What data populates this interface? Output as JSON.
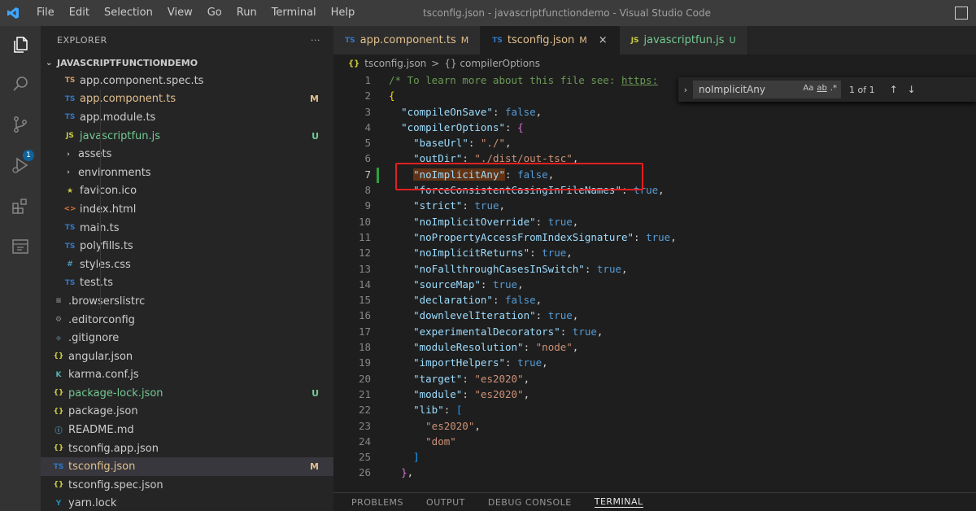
{
  "menu": [
    "File",
    "Edit",
    "Selection",
    "View",
    "Go",
    "Run",
    "Terminal",
    "Help"
  ],
  "window_title": "tsconfig.json - javascriptfunctiondemo - Visual Studio Code",
  "activity_badge": "1",
  "explorer": {
    "header": "EXPLORER",
    "more": "···",
    "root": "JAVASCRIPTFUNCTIONDEMO",
    "items": [
      {
        "icon": "TS",
        "label": "app.component.spec.ts",
        "badge": "",
        "color": "#cccccc",
        "icon_color": "#d19a66"
      },
      {
        "icon": "TS",
        "label": "app.component.ts",
        "badge": "M",
        "color": "#e2c08d",
        "icon_color": "#3178c6"
      },
      {
        "icon": "TS",
        "label": "app.module.ts",
        "badge": "",
        "color": "#cccccc",
        "icon_color": "#3178c6"
      },
      {
        "icon": "JS",
        "label": "javascriptfun.js",
        "badge": "U",
        "color": "#73c991",
        "icon_color": "#cbcb41"
      },
      {
        "icon": "›",
        "label": "assets",
        "badge": "",
        "color": "#cccccc",
        "icon_color": "#cccccc"
      },
      {
        "icon": "›",
        "label": "environments",
        "badge": "",
        "color": "#cccccc",
        "icon_color": "#cccccc"
      },
      {
        "icon": "★",
        "label": "favicon.ico",
        "badge": "",
        "color": "#cccccc",
        "icon_color": "#cbcb41"
      },
      {
        "icon": "<>",
        "label": "index.html",
        "badge": "",
        "color": "#cccccc",
        "icon_color": "#e37933"
      },
      {
        "icon": "TS",
        "label": "main.ts",
        "badge": "",
        "color": "#cccccc",
        "icon_color": "#3178c6"
      },
      {
        "icon": "TS",
        "label": "polyfills.ts",
        "badge": "",
        "color": "#cccccc",
        "icon_color": "#3178c6"
      },
      {
        "icon": "#",
        "label": "styles.css",
        "badge": "",
        "color": "#cccccc",
        "icon_color": "#519aba"
      },
      {
        "icon": "TS",
        "label": "test.ts",
        "badge": "",
        "color": "#cccccc",
        "icon_color": "#3178c6"
      },
      {
        "icon": "≡",
        "label": ".browserslistrc",
        "badge": "",
        "color": "#cccccc",
        "icon_color": "#8a8a8a"
      },
      {
        "icon": "⚙",
        "label": ".editorconfig",
        "badge": "",
        "color": "#cccccc",
        "icon_color": "#8a8a8a"
      },
      {
        "icon": "◆",
        "label": ".gitignore",
        "badge": "",
        "color": "#cccccc",
        "icon_color": "#41535b"
      },
      {
        "icon": "{}",
        "label": "angular.json",
        "badge": "",
        "color": "#cccccc",
        "icon_color": "#cbcb41"
      },
      {
        "icon": "K",
        "label": "karma.conf.js",
        "badge": "",
        "color": "#cccccc",
        "icon_color": "#56b3b4"
      },
      {
        "icon": "{}",
        "label": "package-lock.json",
        "badge": "U",
        "color": "#73c991",
        "icon_color": "#cbcb41"
      },
      {
        "icon": "{}",
        "label": "package.json",
        "badge": "",
        "color": "#cccccc",
        "icon_color": "#cbcb41"
      },
      {
        "icon": "ⓘ",
        "label": "README.md",
        "badge": "",
        "color": "#cccccc",
        "icon_color": "#519aba"
      },
      {
        "icon": "{}",
        "label": "tsconfig.app.json",
        "badge": "",
        "color": "#cccccc",
        "icon_color": "#cbcb41"
      },
      {
        "icon": "TS",
        "label": "tsconfig.json",
        "badge": "M",
        "color": "#e2c08d",
        "icon_color": "#3178c6",
        "selected": true
      },
      {
        "icon": "{}",
        "label": "tsconfig.spec.json",
        "badge": "",
        "color": "#cccccc",
        "icon_color": "#cbcb41"
      },
      {
        "icon": "Y",
        "label": "yarn.lock",
        "badge": "",
        "color": "#cccccc",
        "icon_color": "#2c8ebb"
      }
    ]
  },
  "tabs": [
    {
      "icon": "TS",
      "label": "app.component.ts",
      "suffix": "M",
      "active": false,
      "color": "#e2c08d",
      "icon_color": "#3178c6"
    },
    {
      "icon": "TS",
      "label": "tsconfig.json",
      "suffix": "M",
      "active": true,
      "color": "#e2c08d",
      "icon_color": "#3178c6",
      "close": "×"
    },
    {
      "icon": "JS",
      "label": "javascriptfun.js",
      "suffix": "U",
      "active": false,
      "color": "#73c991",
      "icon_color": "#cbcb41"
    }
  ],
  "breadcrumb": {
    "file": "tsconfig.json",
    "sep": ">",
    "symbol": "{} compilerOptions"
  },
  "find": {
    "value": "noImplicitAny",
    "options": [
      "Aa",
      "ab",
      ".*"
    ],
    "count": "1 of 1",
    "prev": "↑",
    "next": "↓"
  },
  "code_lines": [
    {
      "n": "1",
      "html": "<span class='c'>/* To learn more about this file see: </span><span class='url'>https:</span>"
    },
    {
      "n": "2",
      "html": "<span class='br'>{</span>"
    },
    {
      "n": "3",
      "html": "  <span class='k'>\"compileOnSave\"</span><span class='p'>: </span><span class='b'>false</span><span class='p'>,</span>"
    },
    {
      "n": "4",
      "html": "  <span class='k'>\"compilerOptions\"</span><span class='p'>: </span><span class='br2'>{</span>"
    },
    {
      "n": "5",
      "html": "    <span class='k'>\"baseUrl\"</span><span class='p'>: </span><span class='s'>\"./\"</span><span class='p'>,</span>"
    },
    {
      "n": "6",
      "html": "    <span class='k'>\"outDir\"</span><span class='p'>: </span><span class='s'>\"./dist/out-tsc\"</span><span class='p'>,</span>"
    },
    {
      "n": "7",
      "html": "    <span class='k hl'>\"noImplicitAny\"</span><span class='p'>: </span><span class='b'>false</span><span class='p'>,</span>"
    },
    {
      "n": "8",
      "html": "    <span class='k'>\"forceConsistentCasingInFileNames\"</span><span class='p'>: </span><span class='b'>true</span><span class='p'>,</span>"
    },
    {
      "n": "9",
      "html": "    <span class='k'>\"strict\"</span><span class='p'>: </span><span class='b'>true</span><span class='p'>,</span>"
    },
    {
      "n": "10",
      "html": "    <span class='k'>\"noImplicitOverride\"</span><span class='p'>: </span><span class='b'>true</span><span class='p'>,</span>"
    },
    {
      "n": "11",
      "html": "    <span class='k'>\"noPropertyAccessFromIndexSignature\"</span><span class='p'>: </span><span class='b'>true</span><span class='p'>,</span>"
    },
    {
      "n": "12",
      "html": "    <span class='k'>\"noImplicitReturns\"</span><span class='p'>: </span><span class='b'>true</span><span class='p'>,</span>"
    },
    {
      "n": "13",
      "html": "    <span class='k'>\"noFallthroughCasesInSwitch\"</span><span class='p'>: </span><span class='b'>true</span><span class='p'>,</span>"
    },
    {
      "n": "14",
      "html": "    <span class='k'>\"sourceMap\"</span><span class='p'>: </span><span class='b'>true</span><span class='p'>,</span>"
    },
    {
      "n": "15",
      "html": "    <span class='k'>\"declaration\"</span><span class='p'>: </span><span class='b'>false</span><span class='p'>,</span>"
    },
    {
      "n": "16",
      "html": "    <span class='k'>\"downlevelIteration\"</span><span class='p'>: </span><span class='b'>true</span><span class='p'>,</span>"
    },
    {
      "n": "17",
      "html": "    <span class='k'>\"experimentalDecorators\"</span><span class='p'>: </span><span class='b'>true</span><span class='p'>,</span>"
    },
    {
      "n": "18",
      "html": "    <span class='k'>\"moduleResolution\"</span><span class='p'>: </span><span class='s'>\"node\"</span><span class='p'>,</span>"
    },
    {
      "n": "19",
      "html": "    <span class='k'>\"importHelpers\"</span><span class='p'>: </span><span class='b'>true</span><span class='p'>,</span>"
    },
    {
      "n": "20",
      "html": "    <span class='k'>\"target\"</span><span class='p'>: </span><span class='s'>\"es2020\"</span><span class='p'>,</span>"
    },
    {
      "n": "21",
      "html": "    <span class='k'>\"module\"</span><span class='p'>: </span><span class='s'>\"es2020\"</span><span class='p'>,</span>"
    },
    {
      "n": "22",
      "html": "    <span class='k'>\"lib\"</span><span class='p'>: </span><span class='br3'>[</span>"
    },
    {
      "n": "23",
      "html": "      <span class='s'>\"es2020\"</span><span class='p'>,</span>"
    },
    {
      "n": "24",
      "html": "      <span class='s'>\"dom\"</span>"
    },
    {
      "n": "25",
      "html": "    <span class='br3'>]</span>"
    },
    {
      "n": "26",
      "html": "  <span class='br2'>}</span><span class='p'>,</span>"
    }
  ],
  "panel_tabs": [
    {
      "label": "PROBLEMS",
      "active": false
    },
    {
      "label": "OUTPUT",
      "active": false
    },
    {
      "label": "DEBUG CONSOLE",
      "active": false
    },
    {
      "label": "TERMINAL",
      "active": true
    }
  ]
}
